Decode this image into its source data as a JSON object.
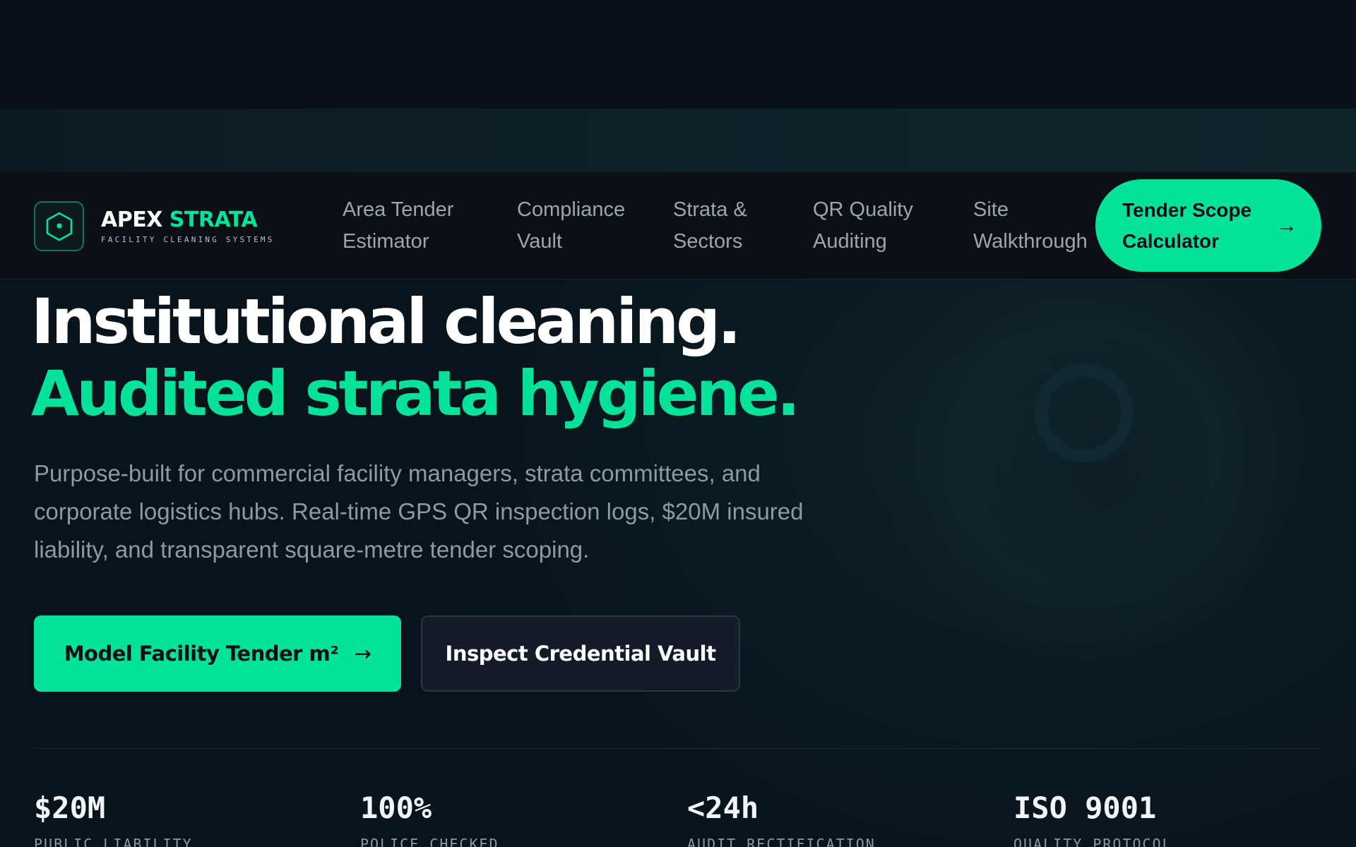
{
  "brand": {
    "name_part1": "APEX",
    "name_part2": "STRATA",
    "tagline": "FACILITY CLEANING SYSTEMS",
    "icon": "hexagon-logo-icon"
  },
  "nav": {
    "links": [
      {
        "line1": "Area Tender",
        "line2": "Estimator"
      },
      {
        "line1": "Compliance",
        "line2": "Vault"
      },
      {
        "line1": "Strata &",
        "line2": "Sectors"
      },
      {
        "line1": "QR Quality",
        "line2": "Auditing"
      },
      {
        "line1": "Site",
        "line2": "Walkthrough"
      }
    ],
    "cta": {
      "line1": "Tender Scope",
      "line2": "Calculator",
      "arrow": "→"
    }
  },
  "hero": {
    "headline_1": "Institutional cleaning.",
    "headline_2": "Audited strata hygiene.",
    "lead": "Purpose-built for commercial facility managers, strata committees, and corporate logistics hubs. Real-time GPS QR inspection logs, $20M insured liability, and transparent square-metre tender scoping.",
    "primary_button": "Model Facility Tender m²",
    "primary_arrow": "→",
    "secondary_button": "Inspect Credential Vault"
  },
  "stats": [
    {
      "value": "$20M",
      "label": "PUBLIC LIABILITY"
    },
    {
      "value": "100%",
      "label": "POLICE CHECKED"
    },
    {
      "value": "<24h",
      "label": "AUDIT RECTIFICATION"
    },
    {
      "value": "ISO 9001",
      "label": "QUALITY PROTOCOL"
    }
  ],
  "colors": {
    "accent": "#05e39a",
    "background": "#08111a",
    "nav_background": "#0a1016",
    "muted_text": "#8d99a4"
  }
}
